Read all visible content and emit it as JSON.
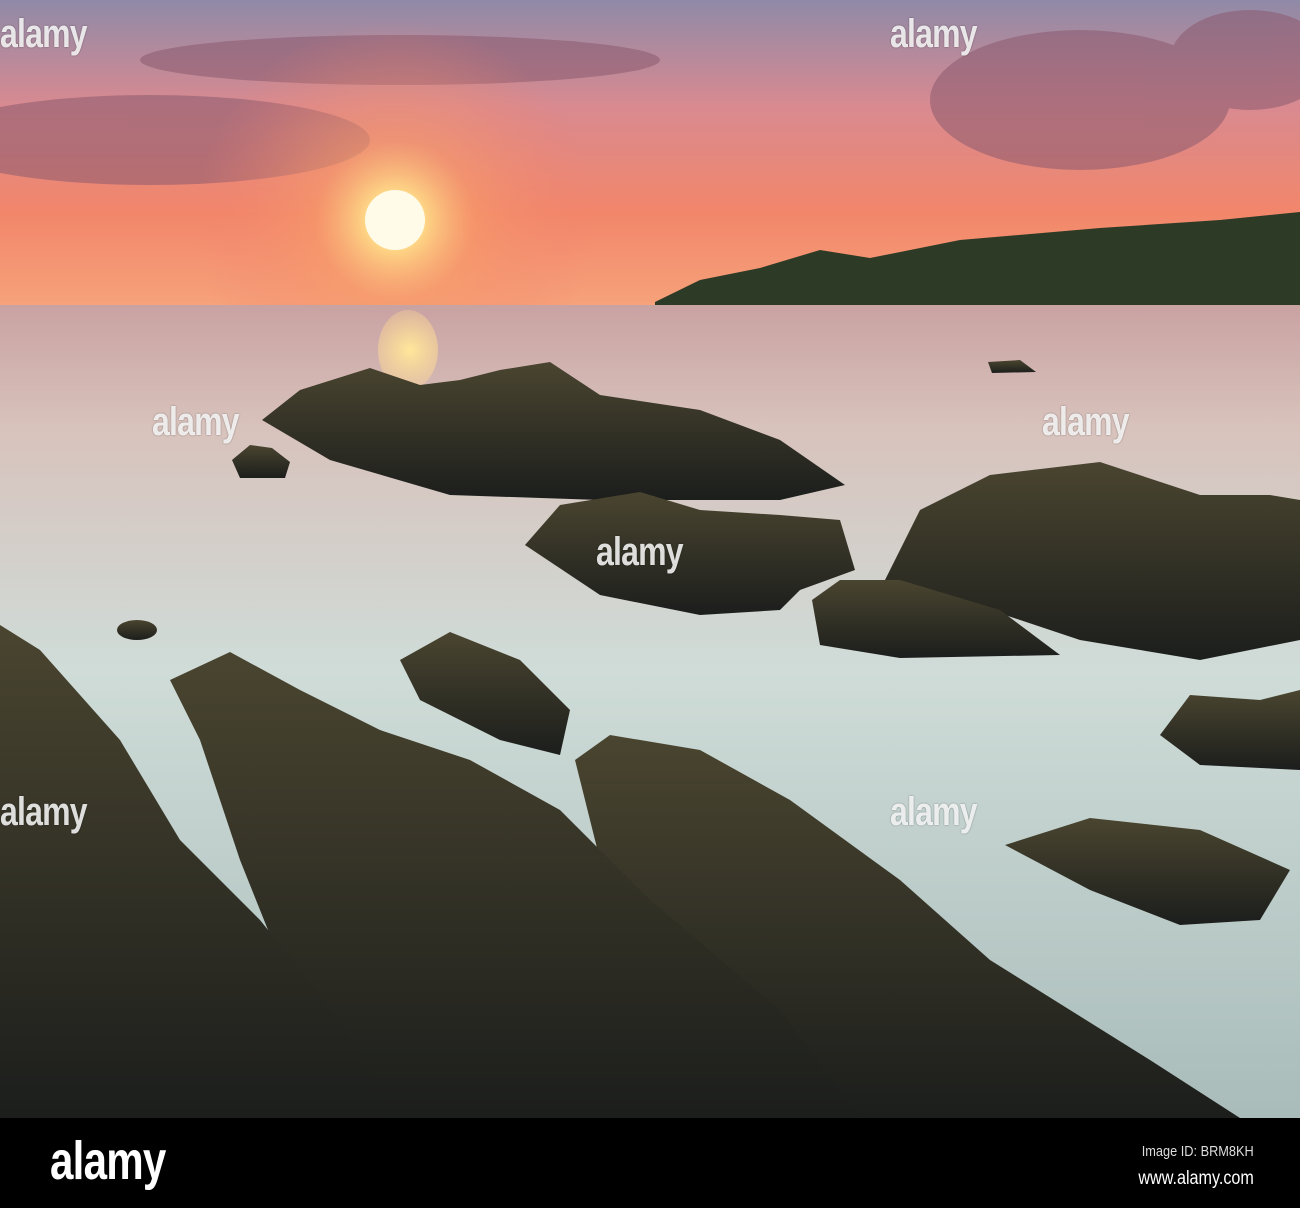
{
  "photo": {
    "subject": "Sunset over a rocky beach with a headland",
    "watermark": "alamy",
    "colors": {
      "sky_top": "#8a8fb0",
      "sky_glow": "#f0785a",
      "sun": "#fff6c8",
      "water": "#cfd9d6",
      "rock": "#2a2a22",
      "headland": "#2c3a26"
    }
  },
  "footer": {
    "logo": "alamy",
    "image_id": "Image ID: BRM8KH",
    "url": "www.alamy.com"
  }
}
